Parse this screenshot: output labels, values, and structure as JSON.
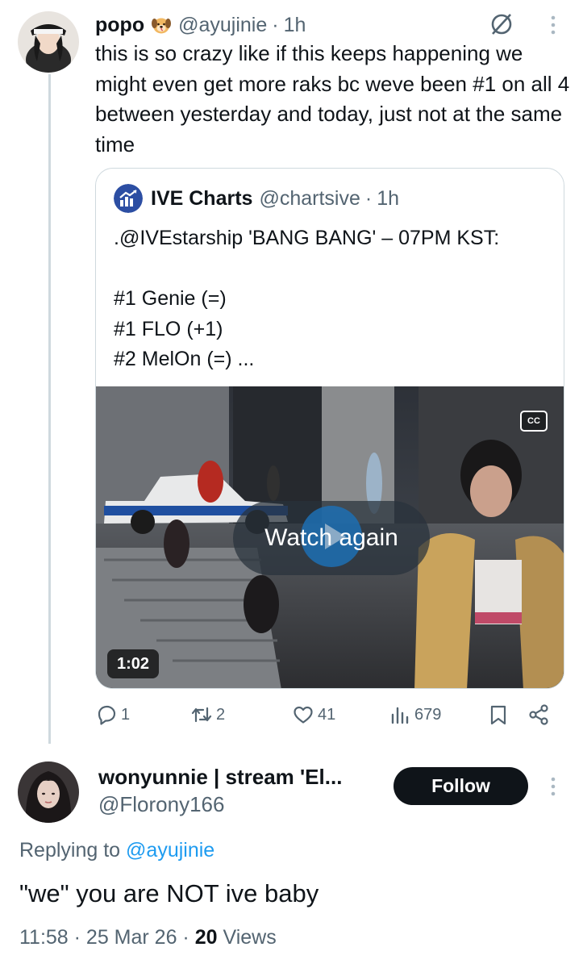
{
  "main_tweet": {
    "display_name": "popo",
    "handle": "@ayujinie",
    "separator": "·",
    "time": "1h",
    "text": "this is so crazy like if this keeps happening we might even get more raks bc weve been #1 on all 4 between yesterday and today, just not at the same time"
  },
  "quoted_tweet": {
    "display_name": "IVE Charts",
    "handle": "@chartsive",
    "separator": "·",
    "time": "1h",
    "lines": [
      ".@IVEstarship 'BANG BANG' – 07PM KST:",
      "",
      "#1 Genie (=)",
      "#1 FLO (+1)",
      "#2 MelOn (=) ..."
    ],
    "video": {
      "cc_label": "CC",
      "overlay_label": "Watch again",
      "duration": "1:02"
    }
  },
  "actions": {
    "replies": "1",
    "reposts": "2",
    "likes": "41",
    "views": "679"
  },
  "reply_tweet": {
    "display_name": "wonyunnie | stream 'El...",
    "handle": "@Florony166",
    "follow_label": "Follow",
    "replying_prefix": "Replying to",
    "replying_to": "@ayujinie",
    "text": "\"we\" you are NOT ive baby",
    "timestamp": "11:58 · 25 Mar 26 ·",
    "views_count": "20",
    "views_label": "Views"
  },
  "icons": {
    "grok": "grok-icon",
    "more": "more-vertical-icon",
    "reply": "reply-icon",
    "repost": "repost-icon",
    "like": "heart-icon",
    "views": "views-icon",
    "bookmark": "bookmark-icon",
    "share": "share-icon"
  },
  "colors": {
    "text": "#0f1419",
    "muted": "#536471",
    "link": "#1d9bf0",
    "follow_button": "#0f1419",
    "thread_line": "#cfd9de"
  }
}
